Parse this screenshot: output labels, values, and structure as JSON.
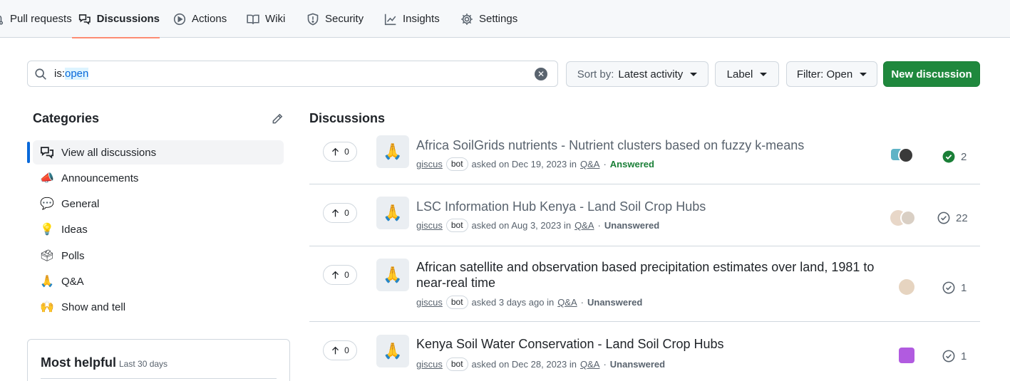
{
  "nav": {
    "tabs": [
      {
        "label": "Pull requests",
        "icon": "git-pull-request-icon"
      },
      {
        "label": "Discussions",
        "icon": "comment-discussion-icon",
        "active": true
      },
      {
        "label": "Actions",
        "icon": "play-icon"
      },
      {
        "label": "Wiki",
        "icon": "book-icon"
      },
      {
        "label": "Security",
        "icon": "shield-icon"
      },
      {
        "label": "Insights",
        "icon": "graph-icon"
      },
      {
        "label": "Settings",
        "icon": "gear-icon"
      }
    ]
  },
  "search": {
    "prefix": "is:",
    "value": "open"
  },
  "toolbar": {
    "sort_prefix": "Sort by:",
    "sort_value": "Latest activity",
    "label": "Label",
    "filter": "Filter: Open",
    "new_discussion": "New discussion"
  },
  "categories": {
    "title": "Categories",
    "items": [
      {
        "label": "View all discussions",
        "icon": "comment-discussion-icon",
        "active": true
      },
      {
        "label": "Announcements",
        "icon": "megaphone-icon"
      },
      {
        "label": "General",
        "icon": "speech-balloon-icon"
      },
      {
        "label": "Ideas",
        "icon": "lightbulb-icon"
      },
      {
        "label": "Polls",
        "icon": "ballot-box-icon"
      },
      {
        "label": "Q&A",
        "icon": "pray-icon"
      },
      {
        "label": "Show and tell",
        "icon": "raised-hands-icon"
      }
    ]
  },
  "most_helpful": {
    "title": "Most helpful",
    "subtitle": "Last 30 days"
  },
  "discussions": {
    "title": "Discussions",
    "items": [
      {
        "votes": "0",
        "title": "Africa SoilGrids nutrients - Nutrient clusters based on fuzzy k-means",
        "author": "giscus",
        "badge": "bot",
        "asked": "asked on Dec 19, 2023 in",
        "category": "Q&A",
        "status": "Answered",
        "comments": "2",
        "read": true
      },
      {
        "votes": "0",
        "title": "LSC Information Hub Kenya - Land Soil Crop Hubs",
        "author": "giscus",
        "badge": "bot",
        "asked": "asked on Aug 3, 2023 in",
        "category": "Q&A",
        "status": "Unanswered",
        "comments": "22",
        "read": true
      },
      {
        "votes": "0",
        "title": "African satellite and observation based precipitation estimates over land, 1981 to near-real time",
        "author": "giscus",
        "badge": "bot",
        "asked": "asked 3 days ago in",
        "category": "Q&A",
        "status": "Unanswered",
        "comments": "1",
        "read": false
      },
      {
        "votes": "0",
        "title": "Kenya Soil Water Conservation - Land Soil Crop Hubs",
        "author": "giscus",
        "badge": "bot",
        "asked": "asked on Dec 28, 2023 in",
        "category": "Q&A",
        "status": "Unanswered",
        "comments": "1",
        "read": false
      }
    ]
  },
  "colors": {
    "accent": "#0969da",
    "primary": "#1f883d",
    "answered": "#1a7f37",
    "tab_underline": "#fd8c73"
  }
}
